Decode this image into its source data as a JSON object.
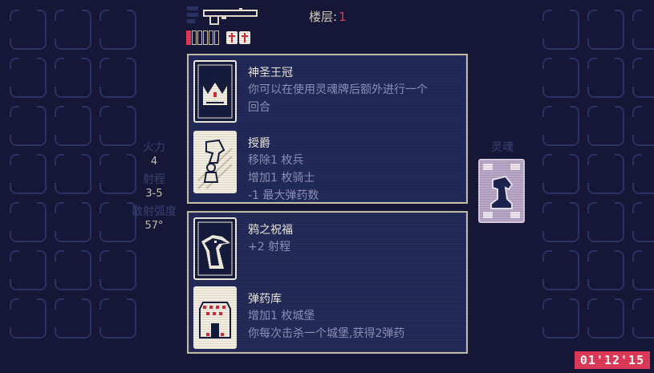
{
  "hud": {
    "floor_label": "楼层:",
    "floor_value": "1",
    "ammo": {
      "filled": 1,
      "total": 6
    },
    "hearts": 2,
    "weapon_icon": "shotgun-icon"
  },
  "stats": [
    {
      "label": "火力",
      "value": "4"
    },
    {
      "label": "射程",
      "value": "3-5"
    },
    {
      "label": "散射弧度",
      "value": "57°"
    }
  ],
  "panels": [
    {
      "entries": [
        {
          "icon": "crown-icon",
          "title": "神圣王冠",
          "lines": [
            "你可以在使用灵魂牌后额外进行一个",
            "回合"
          ]
        },
        {
          "icon": "knight-promotion-icon",
          "title": "授爵",
          "lines": [
            "移除1 枚兵",
            "增加1 枚骑士",
            "-1 最大弹药数"
          ]
        }
      ]
    },
    {
      "entries": [
        {
          "icon": "crow-icon",
          "title": "鸦之祝福",
          "lines": [
            "+2 射程"
          ]
        },
        {
          "icon": "castle-armory-icon",
          "title": "弹药库",
          "lines": [
            "增加1 枚城堡",
            "你每次击杀一个城堡,获得2弹药"
          ]
        }
      ]
    }
  ],
  "soul": {
    "label": "灵魂",
    "icon": "knight-soul-card-icon"
  },
  "timer": "01'12'15",
  "colors": {
    "background": "#17173a",
    "accent": "#e23a5a",
    "panel": "#242b59",
    "panel_border": "#c9c1a8",
    "tile": "#2b3565"
  }
}
